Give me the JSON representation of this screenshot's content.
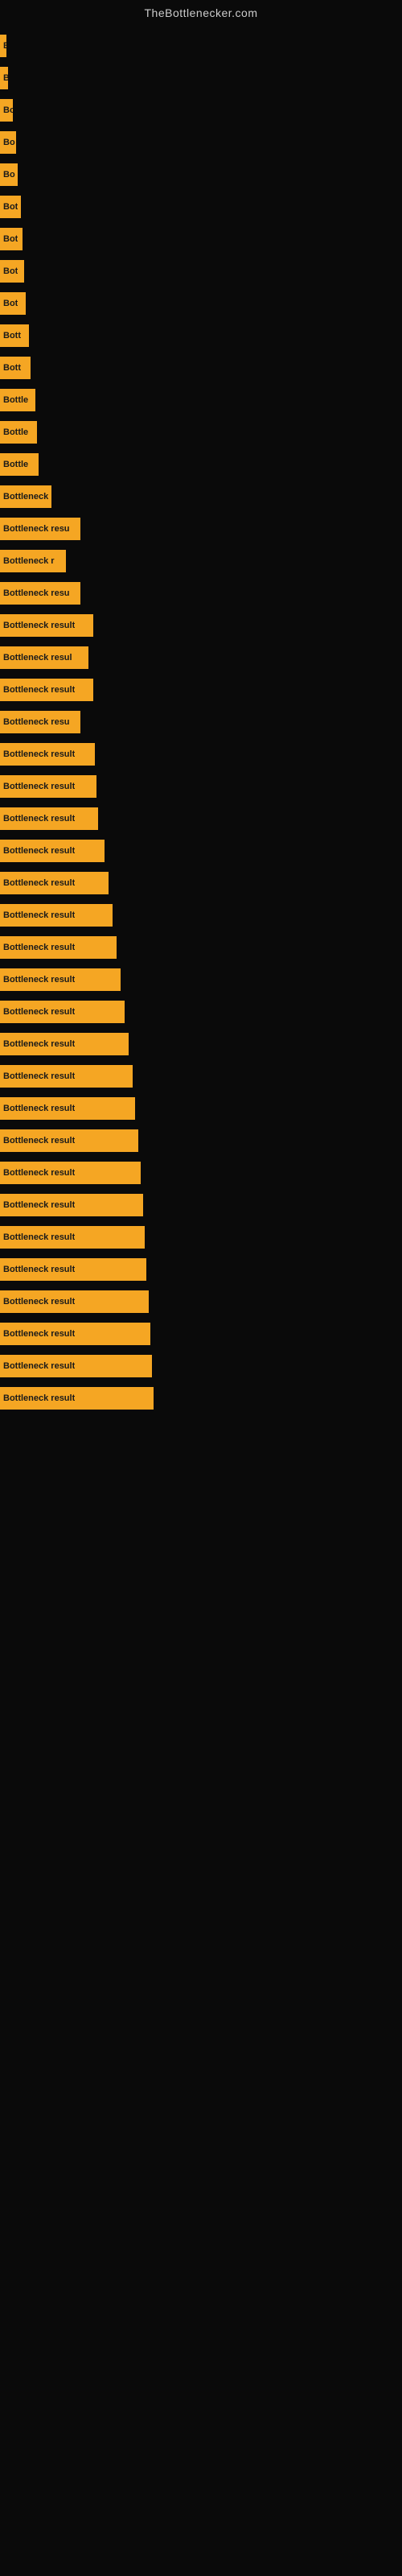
{
  "site": {
    "title": "TheBottlenecker.com"
  },
  "bars": [
    {
      "label": "B",
      "width": 8,
      "rowIndex": 0
    },
    {
      "label": "B",
      "width": 10,
      "rowIndex": 1
    },
    {
      "label": "Bo",
      "width": 16,
      "rowIndex": 2
    },
    {
      "label": "Bo",
      "width": 20,
      "rowIndex": 3
    },
    {
      "label": "Bo",
      "width": 22,
      "rowIndex": 4
    },
    {
      "label": "Bot",
      "width": 26,
      "rowIndex": 5
    },
    {
      "label": "Bot",
      "width": 28,
      "rowIndex": 6
    },
    {
      "label": "Bot",
      "width": 30,
      "rowIndex": 7
    },
    {
      "label": "Bot",
      "width": 32,
      "rowIndex": 8
    },
    {
      "label": "Bott",
      "width": 36,
      "rowIndex": 9
    },
    {
      "label": "Bott",
      "width": 38,
      "rowIndex": 10
    },
    {
      "label": "Bottle",
      "width": 44,
      "rowIndex": 11
    },
    {
      "label": "Bottle",
      "width": 46,
      "rowIndex": 12
    },
    {
      "label": "Bottle",
      "width": 48,
      "rowIndex": 13
    },
    {
      "label": "Bottleneck",
      "width": 64,
      "rowIndex": 14
    },
    {
      "label": "Bottleneck resu",
      "width": 100,
      "rowIndex": 15
    },
    {
      "label": "Bottleneck r",
      "width": 82,
      "rowIndex": 16
    },
    {
      "label": "Bottleneck resu",
      "width": 100,
      "rowIndex": 17
    },
    {
      "label": "Bottleneck result",
      "width": 116,
      "rowIndex": 18
    },
    {
      "label": "Bottleneck resul",
      "width": 110,
      "rowIndex": 19
    },
    {
      "label": "Bottleneck result",
      "width": 116,
      "rowIndex": 20
    },
    {
      "label": "Bottleneck resu",
      "width": 100,
      "rowIndex": 21
    },
    {
      "label": "Bottleneck result",
      "width": 118,
      "rowIndex": 22
    },
    {
      "label": "Bottleneck result",
      "width": 120,
      "rowIndex": 23
    },
    {
      "label": "Bottleneck result",
      "width": 122,
      "rowIndex": 24
    },
    {
      "label": "Bottleneck result",
      "width": 130,
      "rowIndex": 25
    },
    {
      "label": "Bottleneck result",
      "width": 135,
      "rowIndex": 26
    },
    {
      "label": "Bottleneck result",
      "width": 140,
      "rowIndex": 27
    },
    {
      "label": "Bottleneck result",
      "width": 145,
      "rowIndex": 28
    },
    {
      "label": "Bottleneck result",
      "width": 150,
      "rowIndex": 29
    },
    {
      "label": "Bottleneck result",
      "width": 155,
      "rowIndex": 30
    },
    {
      "label": "Bottleneck result",
      "width": 160,
      "rowIndex": 31
    },
    {
      "label": "Bottleneck result",
      "width": 165,
      "rowIndex": 32
    },
    {
      "label": "Bottleneck result",
      "width": 168,
      "rowIndex": 33
    },
    {
      "label": "Bottleneck result",
      "width": 172,
      "rowIndex": 34
    },
    {
      "label": "Bottleneck result",
      "width": 175,
      "rowIndex": 35
    },
    {
      "label": "Bottleneck result",
      "width": 178,
      "rowIndex": 36
    },
    {
      "label": "Bottleneck result",
      "width": 180,
      "rowIndex": 37
    },
    {
      "label": "Bottleneck result",
      "width": 182,
      "rowIndex": 38
    },
    {
      "label": "Bottleneck result",
      "width": 185,
      "rowIndex": 39
    },
    {
      "label": "Bottleneck result",
      "width": 187,
      "rowIndex": 40
    },
    {
      "label": "Bottleneck result",
      "width": 189,
      "rowIndex": 41
    },
    {
      "label": "Bottleneck result",
      "width": 191,
      "rowIndex": 42
    }
  ]
}
